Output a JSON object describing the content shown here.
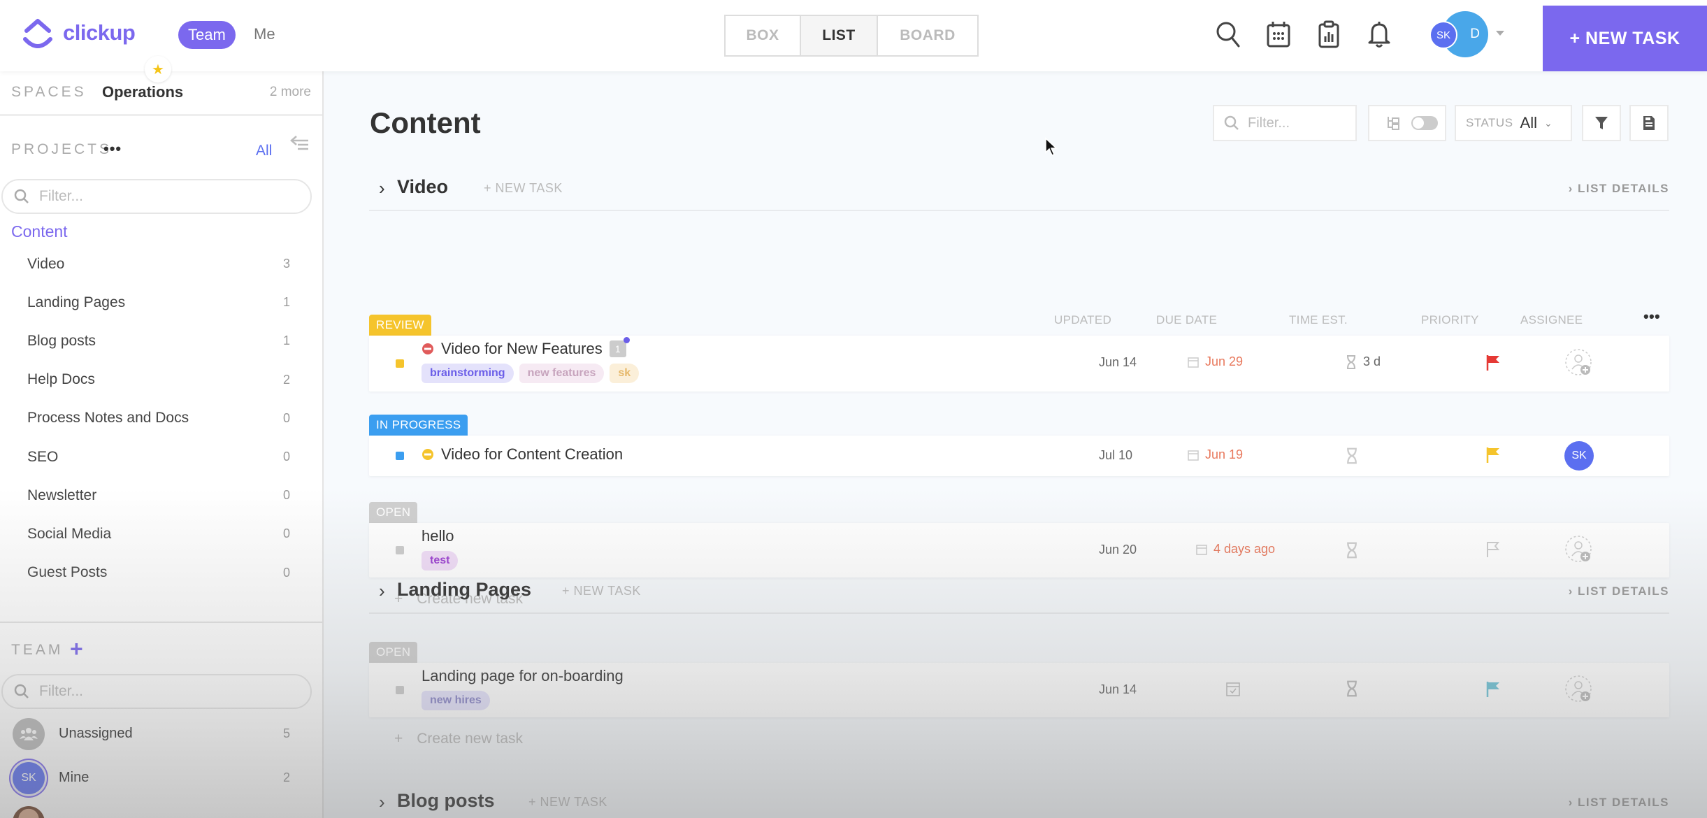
{
  "app": {
    "logo_text": "clickup",
    "brand_color": "#7b68ee",
    "workspace_toggle": {
      "team": "Team",
      "me": "Me",
      "active": "Team"
    }
  },
  "topbar": {
    "views": [
      {
        "label": "BOX",
        "active": false
      },
      {
        "label": "LIST",
        "active": true
      },
      {
        "label": "BOARD",
        "active": false
      }
    ],
    "icons": [
      "search-icon",
      "calendar-icon",
      "clipboard-chart-icon",
      "bell-icon"
    ],
    "user_avatar_initials": "SK",
    "user_avatar_secondary": "D",
    "new_task_label": "+ NEW TASK"
  },
  "sidebar": {
    "spaces_label": "SPACES",
    "current_space": "Operations",
    "more_spaces": "2 more",
    "projects_label": "PROJECTS",
    "projects_menu": "•••",
    "projects_all": "All",
    "projects_filter_placeholder": "Filter...",
    "active_project": "Content",
    "lists": [
      {
        "name": "Video",
        "count": "3"
      },
      {
        "name": "Landing Pages",
        "count": "1"
      },
      {
        "name": "Blog posts",
        "count": "1"
      },
      {
        "name": "Help Docs",
        "count": "2"
      },
      {
        "name": "Process Notes and Docs",
        "count": "0"
      },
      {
        "name": "SEO",
        "count": "0"
      },
      {
        "name": "Newsletter",
        "count": "0"
      },
      {
        "name": "Social Media",
        "count": "0"
      },
      {
        "name": "Guest Posts",
        "count": "0"
      }
    ],
    "team_label": "TEAM",
    "team_add": "+",
    "team_filter_placeholder": "Filter...",
    "team_members": [
      {
        "name": "Unassigned",
        "count": "5",
        "avatar": "group-icon"
      },
      {
        "name": "Mine",
        "count": "2",
        "avatar": "SK"
      },
      {
        "name": "",
        "count": "",
        "avatar": "photo"
      }
    ]
  },
  "main": {
    "title": "Content",
    "toolbar": {
      "filter_placeholder": "Filter...",
      "status_label": "STATUS",
      "status_value": "All"
    },
    "columns": [
      "UPDATED",
      "DUE DATE",
      "TIME EST.",
      "PRIORITY",
      "ASSIGNEE"
    ],
    "columns_menu": "•••",
    "create_task_label": "Create new task",
    "sections": [
      {
        "name": "Video",
        "new_task": "+ NEW TASK",
        "list_details": "LIST DETAILS",
        "groups": [
          {
            "status": "REVIEW",
            "color": "#f5c42c",
            "tasks": [
              {
                "title": "Video for New Features",
                "status_icon": "blocked-icon",
                "status_icon_color": "#e05a5a",
                "subtask_count": "1",
                "tags": [
                  {
                    "label": "brainstorming",
                    "bg": "#e4e2fb",
                    "fg": "#6b5ee8"
                  },
                  {
                    "label": "new features",
                    "bg": "#f6eaf3",
                    "fg": "#c7a4bd"
                  },
                  {
                    "label": "sk",
                    "bg": "#fbefd9",
                    "fg": "#e6b86a"
                  }
                ],
                "updated": "Jun 14",
                "due": "Jun 29",
                "time_est": "3 d",
                "priority": "urgent",
                "priority_color": "#e53935",
                "assignee": ""
              }
            ]
          },
          {
            "status": "IN PROGRESS",
            "color": "#3b9ef0",
            "tasks": [
              {
                "title": "Video for Content Creation",
                "status_icon": "blocked-icon",
                "status_icon_color": "#f5c42c",
                "updated": "Jul 10",
                "due": "Jun 19",
                "time_est": "",
                "priority": "high",
                "priority_color": "#f5c42c",
                "assignee": "SK"
              }
            ]
          },
          {
            "status": "OPEN",
            "color": "#cfcfcf",
            "tasks": [
              {
                "title": "hello",
                "tags": [
                  {
                    "label": "test",
                    "bg": "#f0dcf7",
                    "fg": "#9b3fd1"
                  }
                ],
                "updated": "Jun 20",
                "due": "4 days ago",
                "time_est": "",
                "priority": "none",
                "priority_color": "#cccccc",
                "assignee": ""
              }
            ]
          }
        ]
      },
      {
        "name": "Landing Pages",
        "new_task": "+ NEW TASK",
        "list_details": "LIST DETAILS",
        "groups": [
          {
            "status": "OPEN",
            "color": "#cfcfcf",
            "tasks": [
              {
                "title": "Landing page for on-boarding",
                "tags": [
                  {
                    "label": "new hires",
                    "bg": "#e4e2fb",
                    "fg": "#8a86c8"
                  }
                ],
                "updated": "Jun 14",
                "due": "",
                "time_est": "",
                "priority": "normal",
                "priority_color": "#6fc3d6",
                "assignee": ""
              }
            ]
          }
        ]
      },
      {
        "name": "Blog posts",
        "new_task": "+ NEW TASK",
        "list_details": "LIST DETAILS",
        "groups": []
      }
    ]
  }
}
